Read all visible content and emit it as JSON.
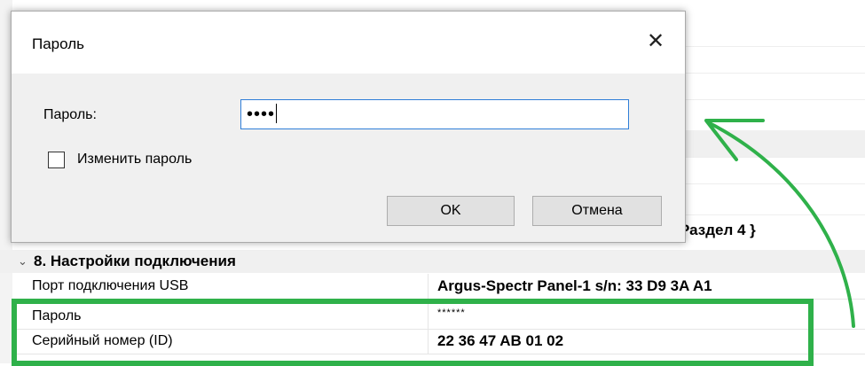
{
  "dialog": {
    "title": "Пароль",
    "close_glyph": "✕",
    "password_label": "Пароль:",
    "password_value": "••••",
    "change_password_label": "Изменить пароль",
    "change_password_checked": false,
    "ok_label": "OK",
    "cancel_label": "Отмена"
  },
  "grid": {
    "partial_text": "Раздел 4 }",
    "section": {
      "chevron": "⌄",
      "title": "8. Настройки подключения"
    },
    "rows": [
      {
        "name": "Порт подключения USB",
        "value": "Argus-Spectr Panel-1 s/n: 33 D9 3A A1"
      },
      {
        "name": "Пароль",
        "value": "******"
      },
      {
        "name": "Серийный номер (ID)",
        "value": "22 36 47 AB 01 02"
      }
    ]
  },
  "annotation": {
    "highlight_color": "#2fb14a",
    "arrow_color": "#2fb14a"
  }
}
